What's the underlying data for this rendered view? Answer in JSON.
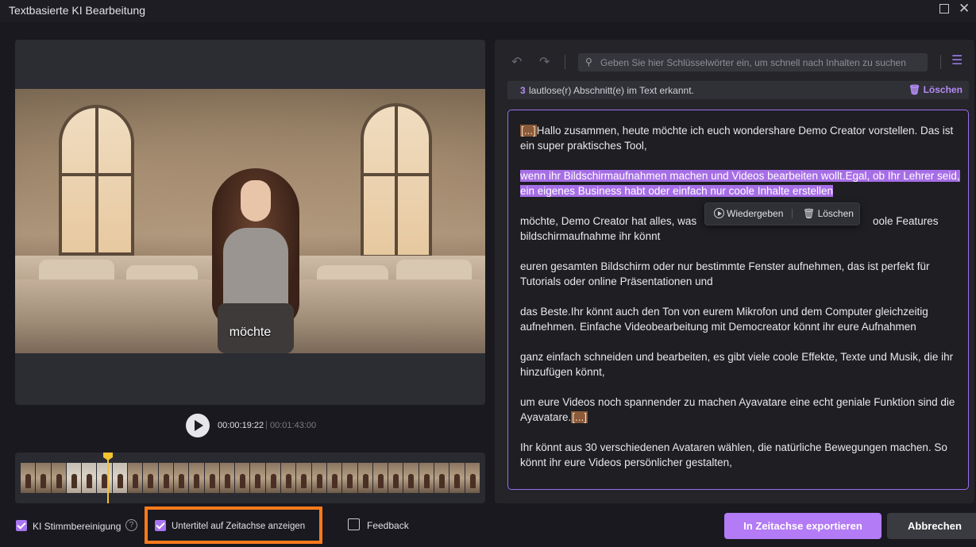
{
  "window": {
    "title": "Textbasierte KI Bearbeitung"
  },
  "player": {
    "subtitle": "möchte",
    "time_current": "00:00:19:22",
    "time_separator": "|",
    "time_total": "00:01:43:00"
  },
  "search": {
    "placeholder": "Geben Sie hier Schlüsselwörter ein, um schnell nach Inhalten zu suchen"
  },
  "silence": {
    "count": "3",
    "text": "lautlose(r) Abschnitt(e) im Text erkannt.",
    "delete_label": "Löschen"
  },
  "transcript": {
    "tag": "[...]",
    "p1": "Hallo zusammen, heute möchte ich euch wondershare Demo Creator vorstellen. Das ist ein super praktisches Tool,",
    "p2": " wenn ihr Bildschirmaufnahmen machen und Videos bearbeiten wollt.Egal, ob Ihr Lehrer seid, ein eigenes Business habt oder einfach nur coole Inhalte erstellen",
    "p3a": " möchte, Demo Creator hat alles, was",
    "p3b": "oole Features",
    "p3c": "bildschirmaufnahme ihr könnt",
    "p4": " euren gesamten Bildschirm oder nur bestimmte Fenster aufnehmen, das ist perfekt für Tutorials oder online Präsentationen und",
    "p5": " das Beste.Ihr könnt auch den Ton von eurem Mikrofon und dem Computer gleichzeitig aufnehmen. Einfache Videobearbeitung mit Democreator könnt ihr eure Aufnahmen",
    "p6": " ganz einfach schneiden und bearbeiten, es gibt viele coole Effekte, Texte und Musik, die ihr hinzufügen könnt,",
    "p7": " um eure Videos noch spannender zu machen Ayavatare eine echt geniale Funktion sind die Ayavatare.",
    "p8": "Ihr könnt aus 30 verschiedenen Avataren wählen, die natürliche Bewegungen machen. So könnt ihr eure Videos persönlicher gestalten,"
  },
  "popup": {
    "play_label": "Wiedergeben",
    "delete_label": "Löschen"
  },
  "bottom": {
    "voice_clean_label": "KI Stimmbereinigung",
    "help": "?",
    "subtitle_timeline_label": "Untertitel auf Zeitachse anzeigen",
    "feedback_label": "Feedback",
    "export_label": "In Zeitachse exportieren",
    "cancel_label": "Abbrechen"
  },
  "icons": {
    "undo": "undo-icon",
    "redo": "redo-icon",
    "search": "search-icon",
    "filter": "filter-clear-icon",
    "trash": "trash-icon",
    "play": "play-icon",
    "feedback": "feedback-icon"
  },
  "colors": {
    "accent": "#b37bf5",
    "highlight": "#ff7a1a",
    "tag": "#8a5a3a",
    "playhead": "#f2c230"
  }
}
